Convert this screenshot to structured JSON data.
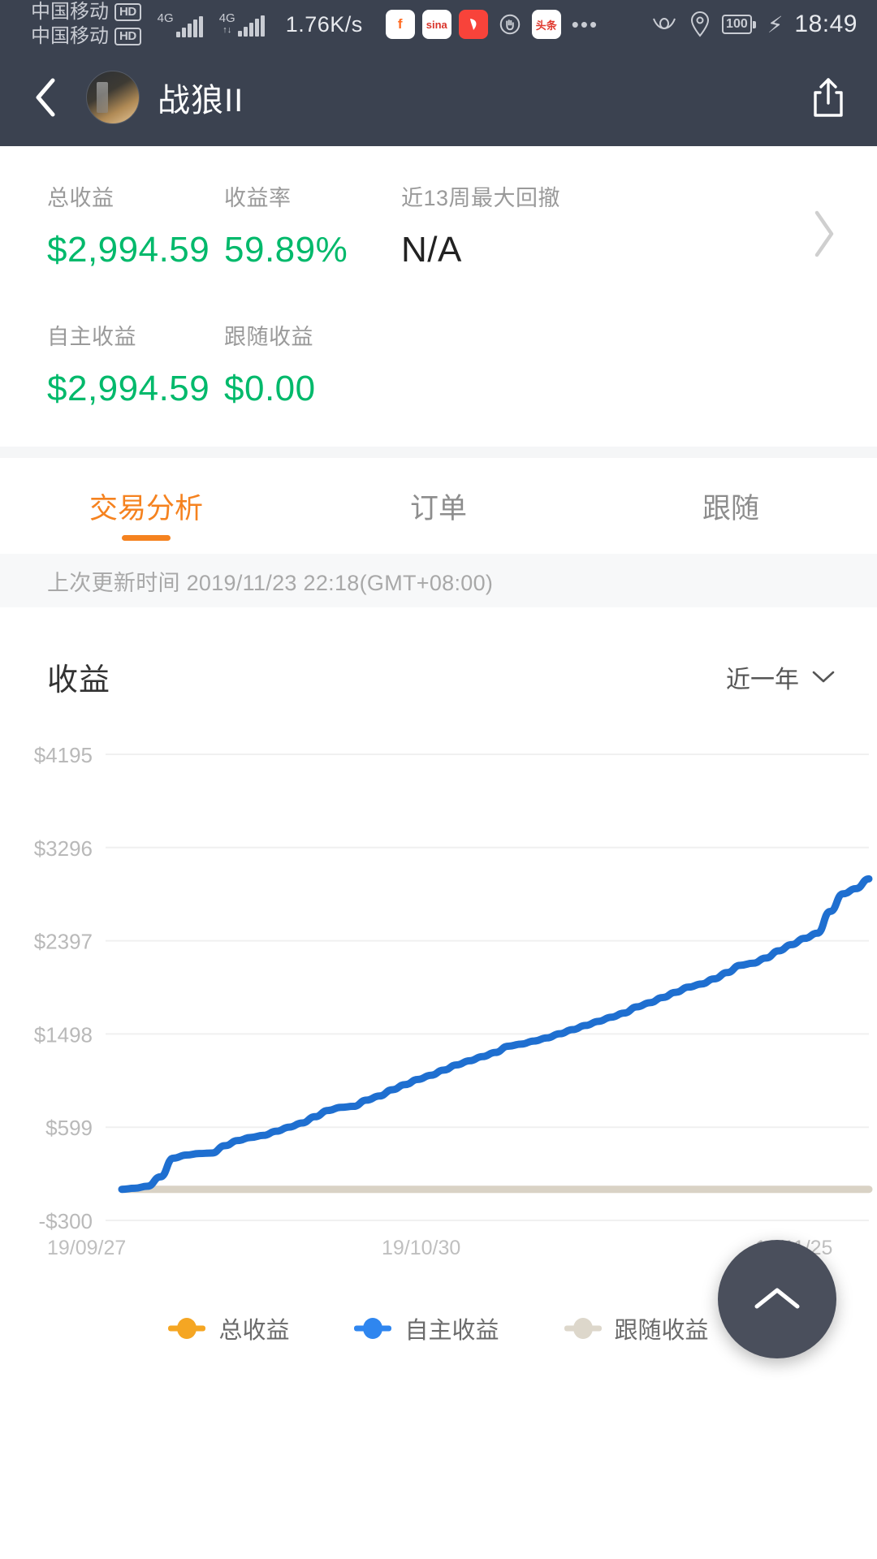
{
  "status_bar": {
    "carrier_line1": "中国移动",
    "carrier_line2": "中国移动",
    "hd_badge": "HD",
    "network_label_1": "4G",
    "network_label_2": "4G",
    "net_speed": "1.76K/s",
    "app_icons": [
      {
        "name": "f-app-icon",
        "glyph": "f"
      },
      {
        "name": "sina-weibo-icon",
        "glyph": "sina"
      },
      {
        "name": "red-app-icon",
        "glyph": "⌁"
      },
      {
        "name": "hand-gesture-icon",
        "glyph": "✋"
      },
      {
        "name": "toutiao-icon",
        "glyph": "头条"
      }
    ],
    "overflow_dots": "•••",
    "battery_level": "100",
    "time": "18:49"
  },
  "header": {
    "back_icon": "chevron-left-icon",
    "title": "战狼II",
    "share_icon": "share-icon"
  },
  "stats": {
    "row1": [
      {
        "label": "总收益",
        "value": "$2,994.59",
        "color": "#00b96b"
      },
      {
        "label": "收益率",
        "value": "59.89%",
        "color": "#00b96b"
      },
      {
        "label": "近13周最大回撤",
        "value": "N/A",
        "color": "#222222"
      }
    ],
    "row2": [
      {
        "label": "自主收益",
        "value": "$2,994.59",
        "color": "#00b96b"
      },
      {
        "label": "跟随收益",
        "value": "$0.00",
        "color": "#00b96b"
      }
    ],
    "arrow_icon": "chevron-right-icon"
  },
  "tabs": [
    {
      "label": "交易分析",
      "active": true
    },
    {
      "label": "订单",
      "active": false
    },
    {
      "label": "跟随",
      "active": false
    }
  ],
  "update_bar": {
    "text": "上次更新时间 2019/11/23 22:18(GMT+08:00)"
  },
  "chart_header": {
    "title": "收益",
    "range_label": "近一年",
    "dropdown_icon": "chevron-down-icon"
  },
  "fab": {
    "icon": "chevron-up-icon"
  },
  "colors": {
    "accent_orange": "#f5821f",
    "green": "#00b96b",
    "blue": "#1f6fd0",
    "beige": "#d9d2c5",
    "header_bg": "#3b4250"
  },
  "chart_data": {
    "type": "line",
    "title": "收益",
    "xlabel": "",
    "ylabel": "",
    "grid": true,
    "legend_position": "bottom",
    "ylim": [
      -300,
      4195
    ],
    "ytick_labels": [
      "$4195",
      "$3296",
      "$2397",
      "$1498",
      "$599",
      "-$300"
    ],
    "ytick_values": [
      4195,
      3296,
      2397,
      1498,
      599,
      -300
    ],
    "xtick_labels": [
      "19/09/27",
      "19/10/30",
      "19/11/25"
    ],
    "x_start": "19/09/27",
    "x_end": "19/11/25",
    "series": [
      {
        "name": "总收益",
        "color": "#f5a623",
        "visible_as_line": false,
        "values": []
      },
      {
        "name": "自主收益",
        "color": "#1f6fd0",
        "visible_as_line": true,
        "x": [
          0,
          1,
          2,
          3,
          4,
          5,
          6,
          7,
          8,
          9,
          10,
          11,
          12,
          13,
          14,
          15,
          16,
          17,
          18,
          19,
          20,
          21,
          22,
          23,
          24,
          25,
          26,
          27,
          28,
          29,
          30,
          31,
          32,
          33,
          34,
          35,
          36,
          37,
          38,
          39,
          40,
          41,
          42,
          43,
          44,
          45,
          46,
          47,
          48,
          49,
          50,
          51,
          52,
          53,
          54,
          55,
          56,
          57,
          58
        ],
        "values": [
          0,
          10,
          30,
          120,
          300,
          330,
          345,
          350,
          420,
          470,
          500,
          520,
          560,
          600,
          640,
          700,
          760,
          790,
          800,
          860,
          900,
          960,
          1010,
          1060,
          1100,
          1150,
          1200,
          1240,
          1280,
          1320,
          1380,
          1400,
          1430,
          1460,
          1500,
          1540,
          1580,
          1620,
          1660,
          1700,
          1760,
          1800,
          1850,
          1900,
          1950,
          1980,
          2030,
          2090,
          2160,
          2180,
          2230,
          2300,
          2360,
          2420,
          2470,
          2680,
          2850,
          2900,
          2994
        ]
      },
      {
        "name": "跟随收益",
        "color": "#d9d2c5",
        "visible_as_line": true,
        "values_constant": 0
      }
    ],
    "legend": [
      {
        "label": "总收益",
        "color": "#f5a623"
      },
      {
        "label": "自主收益",
        "color": "#1f6fd0"
      },
      {
        "label": "跟随收益",
        "color": "#d9d2c5"
      }
    ]
  }
}
